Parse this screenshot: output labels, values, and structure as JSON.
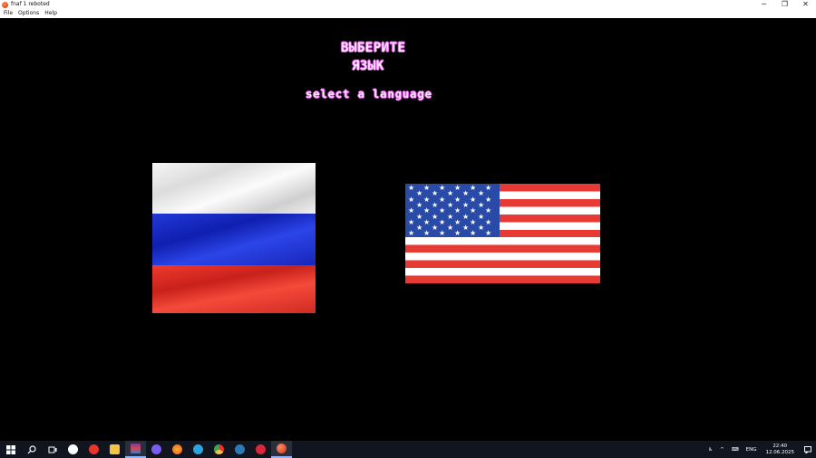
{
  "window": {
    "title": "fnaf 1 reboted",
    "controls": {
      "minimize": "─",
      "restore": "❐",
      "close": "✕"
    }
  },
  "menu": {
    "items": [
      "File",
      "Options",
      "Help"
    ]
  },
  "game": {
    "title_ru_line1": "ВЫБЕРИТЕ",
    "title_ru_line2": "ЯЗЫК",
    "title_en": "select a language",
    "flags": [
      {
        "name": "russia",
        "icon": "russian-flag"
      },
      {
        "name": "usa",
        "icon": "us-flag"
      }
    ],
    "text_color": "#fde6fb",
    "outline_color": "#d04ad8"
  },
  "taskbar": {
    "icons": [
      "windows-start-icon",
      "search-icon",
      "task-view-icon",
      "yandex-browser-icon",
      "yandex-icon",
      "file-explorer-icon",
      "winrar-icon",
      "discord-icon",
      "firefox-icon",
      "telegram-icon",
      "chrome-icon",
      "steam-icon",
      "red-app-icon",
      "fnaf-game-icon"
    ],
    "tray": {
      "language": "ENG",
      "time": "22:40",
      "date": "12.06.2025"
    }
  }
}
